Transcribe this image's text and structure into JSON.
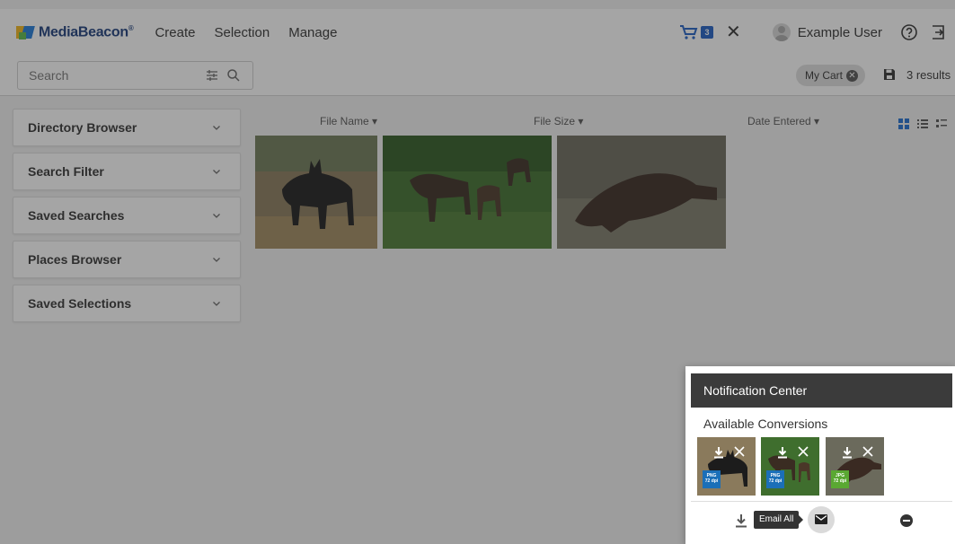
{
  "app": {
    "logo_text": "MediaBeacon",
    "logo_mark": "®"
  },
  "nav": {
    "items": [
      "Create",
      "Selection",
      "Manage"
    ]
  },
  "header": {
    "cart_count": "3",
    "close_glyph": "✕",
    "user_name": "Example User"
  },
  "search": {
    "placeholder": "Search"
  },
  "toolbar": {
    "cart_pill_label": "My Cart",
    "pill_close_glyph": "✕",
    "results_text": "3 results"
  },
  "sidebar": {
    "panels": [
      {
        "label": "Directory Browser"
      },
      {
        "label": "Search Filter"
      },
      {
        "label": "Saved Searches"
      },
      {
        "label": "Places Browser"
      },
      {
        "label": "Saved Selections"
      }
    ]
  },
  "columns": {
    "file_name": "File Name ▾",
    "file_size": "File Size ▾",
    "date_entered": "Date Entered ▾"
  },
  "results": {
    "items": [
      {
        "subject": "black wolf standing in dry grass"
      },
      {
        "subject": "moose with calves in green forest"
      },
      {
        "subject": "platypus on gravel"
      }
    ]
  },
  "notification": {
    "title": "Notification Center",
    "subtitle": "Available Conversions",
    "conversions": [
      {
        "format": "PNG",
        "dpi": "72 dpi",
        "badge_color": "#1b6fb8"
      },
      {
        "format": "PNG",
        "dpi": "72 dpi",
        "badge_color": "#1b6fb8"
      },
      {
        "format": "JPG",
        "dpi": "72 dpi",
        "badge_color": "#5aa832"
      }
    ],
    "email_tooltip": "Email All"
  }
}
